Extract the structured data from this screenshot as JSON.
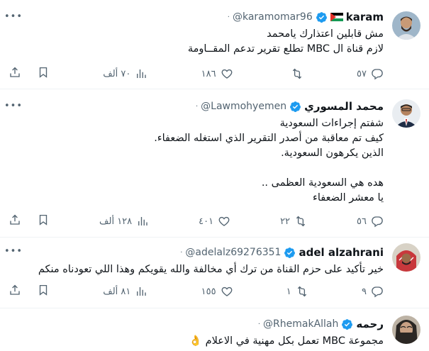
{
  "tweets": [
    {
      "name": "karam",
      "handle": "@karamomar96",
      "dot": "·",
      "text": "مش قابلين اعتذارك يامحمد\nلازم قناة ال MBC تطلع تقرير تدعم المقــاومة",
      "replies": "٥٧",
      "retweets": "",
      "likes": "١٨٦",
      "views": "٧٠ ألف"
    },
    {
      "name": "محمد المسوري",
      "handle": "@Lawmohyemen",
      "dot": "·",
      "text": "شفتم إجراءات السعودية\nكيف تم معاقبة من أصدر التقرير الذي استغله الضعفاء.\nالذين يكرهون السعودية.\n\nهده هي السعودية العظمى ..\nيا معشر الضعفاء",
      "replies": "٥٦",
      "retweets": "٢٢",
      "likes": "٤٠١",
      "views": "١٢٨ ألف"
    },
    {
      "name": "adel alzahrani",
      "handle": "@adelalz69276351",
      "dot": "·",
      "text": "خير تأكيد على حزم القناة من ترك أي مخالفة والله يقويكم وهذا اللي تعودناه منكم",
      "replies": "٩",
      "retweets": "١",
      "likes": "١٥٥",
      "views": "٨١ ألف"
    },
    {
      "name": "رحمه",
      "handle": "@RhemakAllah",
      "dot": "·",
      "text": "مجموعة MBC تعمل بكل مهنية في الاعلام 👌",
      "replies": "",
      "retweets": "",
      "likes": "",
      "views": ""
    }
  ],
  "icons": {
    "more": "more-dots-icon",
    "verified": "verified-badge-icon",
    "reply": "reply-icon",
    "retweet": "retweet-icon",
    "like": "like-icon",
    "views": "views-icon",
    "bookmark": "bookmark-icon",
    "share": "share-icon"
  },
  "colors": {
    "verified": "#1d9bf0",
    "secondary_text": "#536471",
    "text": "#0f1419",
    "divider": "#eff3f4"
  }
}
